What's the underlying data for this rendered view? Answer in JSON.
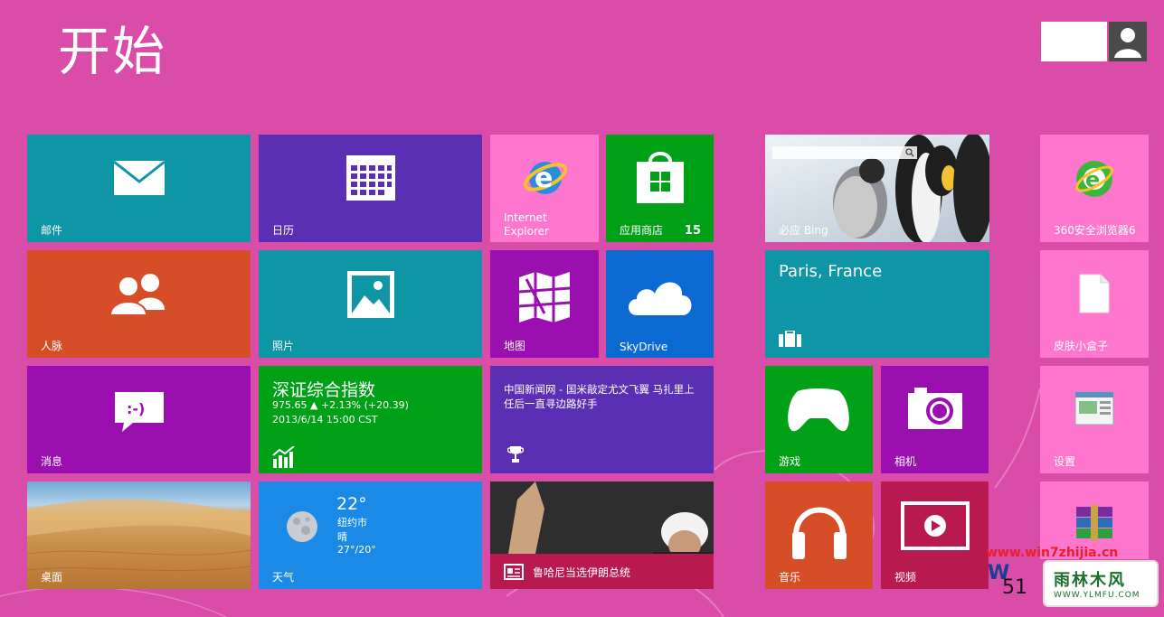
{
  "header": {
    "title": "开始"
  },
  "colors": {
    "background": "#d94ca8",
    "teal": "#0f96a6",
    "purple": "#5b2fb3",
    "pink": "#ff76cf",
    "green": "#00a116",
    "orange": "#d64e27",
    "magenta": "#9b0fb0",
    "blue": "#0a6ad1",
    "crimson": "#b8194e"
  },
  "tiles": {
    "mail": {
      "label": "邮件",
      "icon": "mail-icon"
    },
    "calendar": {
      "label": "日历",
      "icon": "calendar-icon"
    },
    "ie": {
      "label": "Internet Explorer",
      "icon": "ie-icon"
    },
    "store": {
      "label": "应用商店",
      "badge": "15",
      "icon": "store-icon"
    },
    "bing": {
      "label": "必应 Bing",
      "icon": "search-icon"
    },
    "browser360": {
      "label": "360安全浏览器6",
      "icon": "360-browser-icon"
    },
    "people": {
      "label": "人脉",
      "icon": "people-icon"
    },
    "photos": {
      "label": "照片",
      "icon": "photo-icon"
    },
    "maps": {
      "label": "地图",
      "icon": "map-icon"
    },
    "skydrive": {
      "label": "SkyDrive",
      "icon": "cloud-icon"
    },
    "travel": {
      "label": "Paris, France",
      "icon": "suitcase-icon"
    },
    "skinbox": {
      "label": "皮肤小盒子",
      "icon": "file-icon"
    },
    "messaging": {
      "label": "消息",
      "icon": "chat-icon"
    },
    "finance": {
      "title": "深证综合指数",
      "value": "975.65  ▲ +2.13% (+20.39)",
      "time": "2013/6/14 15:00 CST",
      "icon": "chart-icon"
    },
    "sports": {
      "text": "中国新闻网 - 国米敲定尤文飞翼 马扎里上任后一直寻边路好手",
      "icon": "trophy-icon"
    },
    "games": {
      "label": "游戏",
      "icon": "xbox-controller-icon"
    },
    "camera": {
      "label": "相机",
      "icon": "camera-icon"
    },
    "settings": {
      "label": "设置",
      "icon": "settings-window-icon"
    },
    "desktop": {
      "label": "桌面",
      "icon": "desert-icon"
    },
    "weather": {
      "label": "天气",
      "temp": "22°",
      "city": "纽约市",
      "condition": "晴",
      "range": "27°/20°",
      "icon": "moon-icon"
    },
    "news": {
      "label": "鲁哈尼当选伊朗总统",
      "icon": "news-icon"
    },
    "music": {
      "label": "音乐",
      "icon": "headphones-icon"
    },
    "video": {
      "label": "视频",
      "icon": "video-icon"
    },
    "winrar": {
      "icon": "winrar-icon"
    }
  },
  "watermark": {
    "url": "www.win7zhijia.cn",
    "name": "雨林木风",
    "site": "WWW.YLMFU.COM",
    "prefix": "51"
  }
}
